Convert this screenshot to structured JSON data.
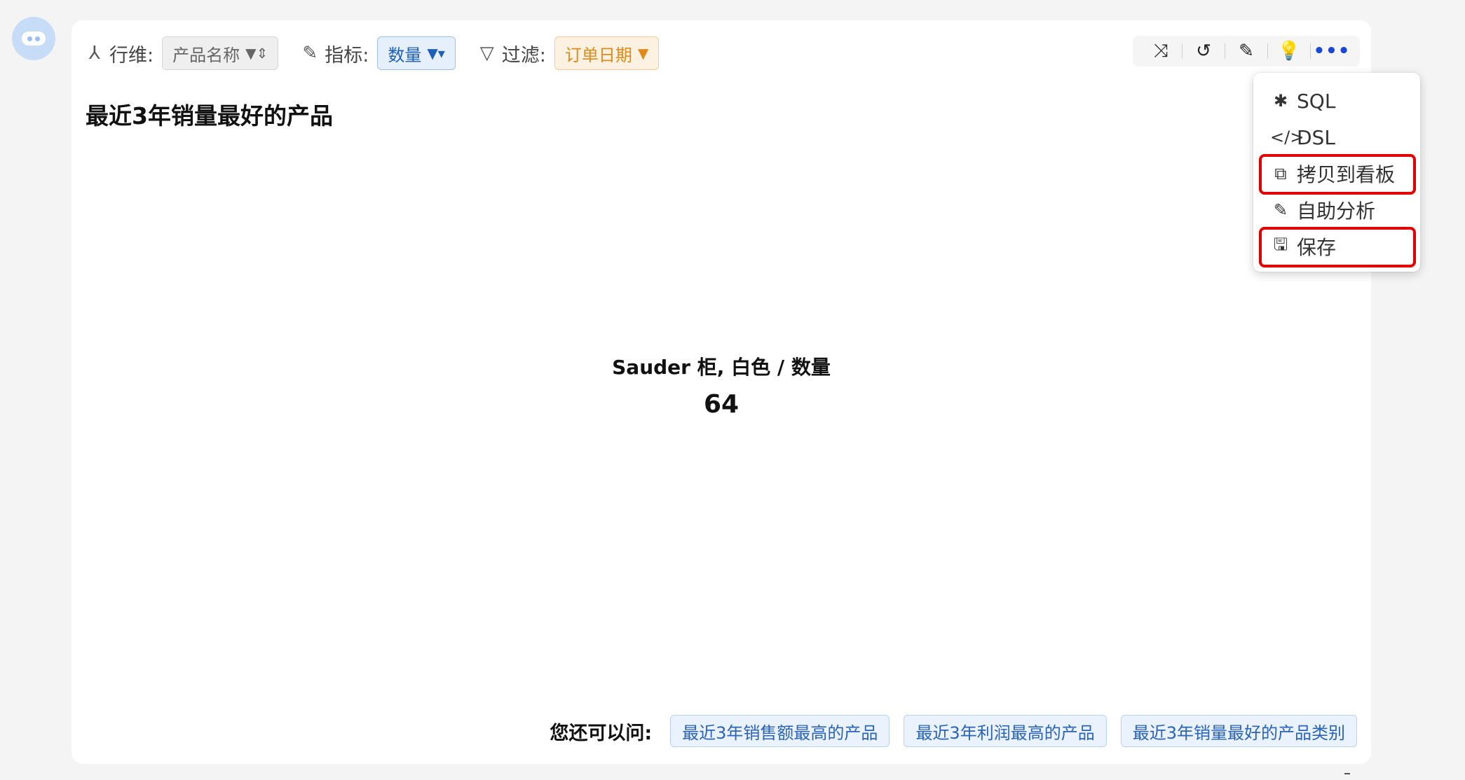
{
  "toolbar": {
    "row_dim": {
      "label": "行维:",
      "value": "产品名称",
      "icon": "hierarchy-icon"
    },
    "metric": {
      "label": "指标:",
      "value": "数量",
      "icon": "ruler-icon"
    },
    "filter": {
      "label": "过滤:",
      "value": "订单日期",
      "icon": "filter-icon"
    }
  },
  "actions": [
    "shuffle-icon",
    "refresh-icon",
    "edit-icon",
    "lightbulb-icon",
    "more-icon"
  ],
  "title": "最近3年销量最好的产品",
  "kpi": {
    "label": "Sauder 柜, 白色 / 数量",
    "value": "64"
  },
  "suggest": {
    "label": "您还可以问:",
    "items": [
      "最近3年销售额最高的产品",
      "最近3年利润最高的产品",
      "最近3年销量最好的产品类别"
    ]
  },
  "menu": {
    "items": [
      {
        "label": "SQL",
        "icon": "bug-icon",
        "highlighted": false
      },
      {
        "label": "DSL",
        "icon": "code-icon",
        "highlighted": false
      },
      {
        "label": "拷贝到看板",
        "icon": "copy-icon",
        "highlighted": true
      },
      {
        "label": "自助分析",
        "icon": "pencil-icon",
        "highlighted": false
      },
      {
        "label": "保存",
        "icon": "save-icon",
        "highlighted": true
      }
    ]
  },
  "colors": {
    "highlight": "#e00000",
    "accent_blue": "#1f5fb8",
    "accent_orange": "#e08a1a"
  }
}
